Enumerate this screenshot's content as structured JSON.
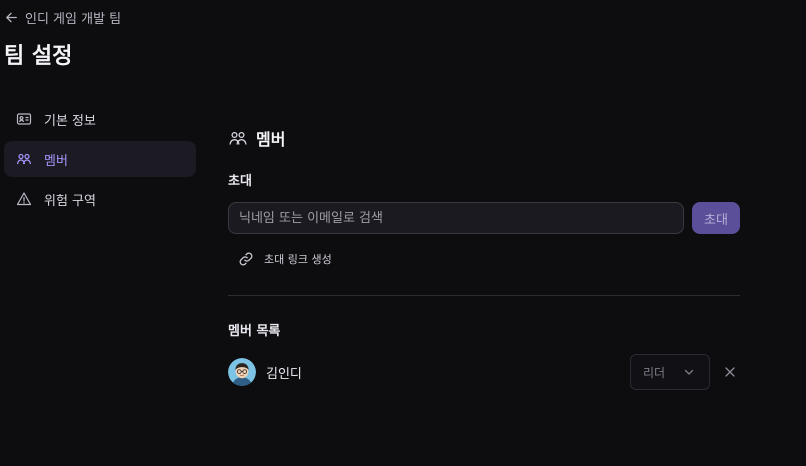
{
  "header": {
    "back_label": "인디 게임 개발 팀",
    "title": "팀 설정"
  },
  "sidebar": {
    "items": [
      {
        "label": "기본 정보",
        "icon": "id-card-icon",
        "active": false
      },
      {
        "label": "멤버",
        "icon": "users-icon",
        "active": true
      },
      {
        "label": "위험 구역",
        "icon": "warning-icon",
        "active": false
      }
    ]
  },
  "members_section": {
    "title": "멤버",
    "icon": "users-icon",
    "invite_label": "초대",
    "search_placeholder": "닉네임 또는 이메일로 검색",
    "invite_button": "초대",
    "invite_link_label": "초대 링크 생성",
    "list_label": "멤버 목록",
    "members": [
      {
        "name": "김인디",
        "role": "리더",
        "avatar": "avatar"
      }
    ]
  },
  "colors": {
    "background": "#0d0c0f",
    "accent": "#a594f9",
    "button": "#5b4f99",
    "active_item_bg": "#1c1b24"
  }
}
